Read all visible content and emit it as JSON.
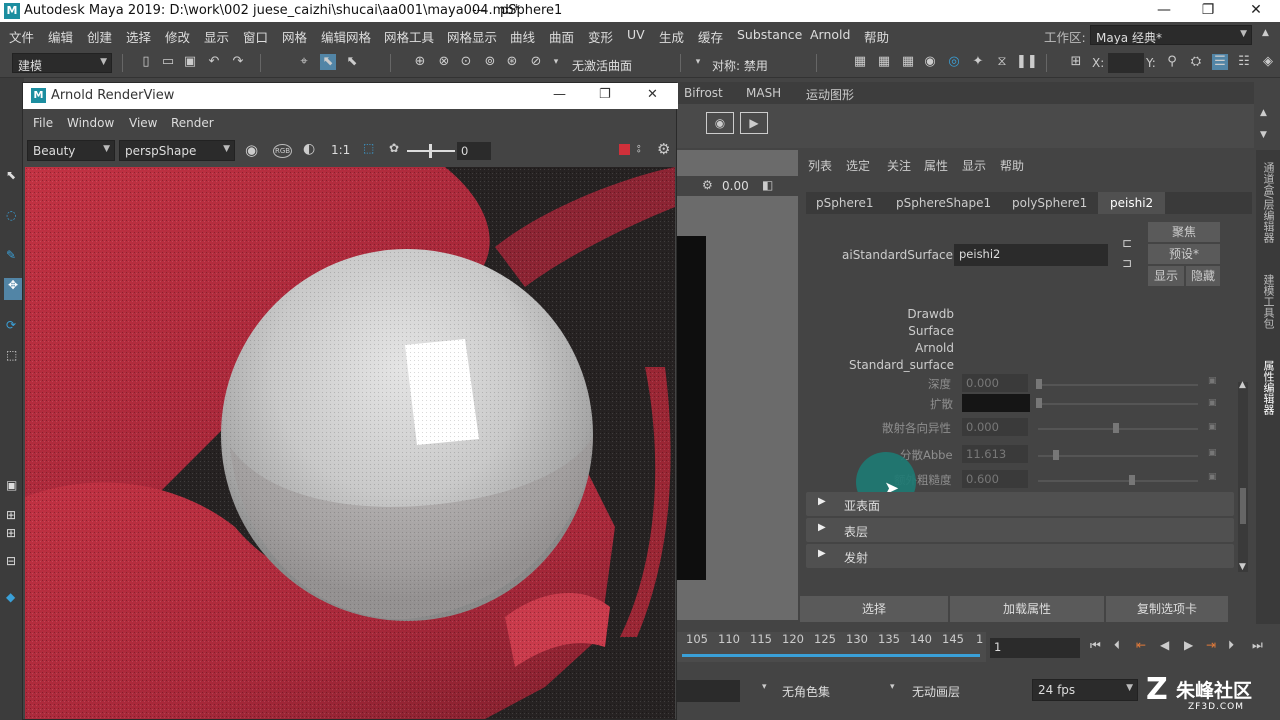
{
  "app": {
    "title": "Autodesk Maya 2019: D:\\work\\002 juese_caizhi\\shucai\\aa001\\maya004.mb*",
    "title_sep": "---",
    "selection": "pSphere1"
  },
  "window_controls": {
    "minimize": "—",
    "maximize": "❐",
    "close": "✕"
  },
  "menubar": {
    "items": [
      "文件",
      "编辑",
      "创建",
      "选择",
      "修改",
      "显示",
      "窗口",
      "网格",
      "编辑网格",
      "网格工具",
      "网格显示",
      "曲线",
      "曲面",
      "变形",
      "UV",
      "生成",
      "缓存",
      "Substance",
      "Arnold",
      "帮助"
    ],
    "workspace_label": "工作区:",
    "workspace_value": "Maya 经典*"
  },
  "shelf": {
    "mode": "建模",
    "live_surface": "无激活曲面",
    "symmetry": "对称: 禁用",
    "x_label": "X:",
    "y_label": "Y:"
  },
  "shelf_tabs": {
    "items": [
      "Bifrost",
      "MASH",
      "运动图形"
    ]
  },
  "arnold_renderview": {
    "title": "Arnold RenderView",
    "menu": [
      "File",
      "Window",
      "View",
      "Render"
    ],
    "aov": "Beauty",
    "camera": "perspShape",
    "ratio": "1:1",
    "exposure": "0",
    "rgb": "RGB"
  },
  "viewport": {
    "value": "0.00"
  },
  "attribute_editor": {
    "menu": [
      "列表",
      "选定",
      "关注",
      "属性",
      "显示",
      "帮助"
    ],
    "tabs": [
      "pSphere1",
      "pSphereShape1",
      "polySphere1",
      "peishi2"
    ],
    "active_tab": "peishi2",
    "node_label": "aiStandardSurface:",
    "node_name": "peishi2",
    "focus_button": "聚焦",
    "preset_button": "预设*",
    "show_button": "显示",
    "hide_button": "隐藏",
    "tooltip_lines": [
      "Drawdb",
      "Surface",
      "Arnold",
      "Standard_surface"
    ],
    "attrs": [
      {
        "label": "深度",
        "value": "0.000"
      },
      {
        "label": "扩散",
        "value": ""
      },
      {
        "label": "散射各向异性",
        "value": "0.000"
      },
      {
        "label": "分散Abbe",
        "value": "11.613"
      },
      {
        "label": "额外粗糙度",
        "value": "0.600"
      }
    ],
    "sections": [
      "亚表面",
      "表层",
      "发射"
    ],
    "bottom_buttons": [
      "选择",
      "加载属性",
      "复制选项卡"
    ]
  },
  "side_tabs": [
    "通道盒/层编辑器",
    "建模工具包",
    "属性编辑器"
  ],
  "timeline": {
    "ticks": [
      "105",
      "110",
      "115",
      "120",
      "125",
      "130",
      "135",
      "140",
      "145",
      "1"
    ],
    "current_frame": "1"
  },
  "statusbar": {
    "character_set": "无角色集",
    "anim_layer": "无动画层",
    "fps": "24 fps"
  },
  "watermark": {
    "text": "朱峰社区",
    "url": "ZF3D.COM"
  },
  "colors": {
    "bg": "#444444",
    "render_red": "#b8303f",
    "sphere": "#cfcfcf",
    "cursor_highlight": "#1e7a73",
    "stop_red": "#d0303a"
  }
}
